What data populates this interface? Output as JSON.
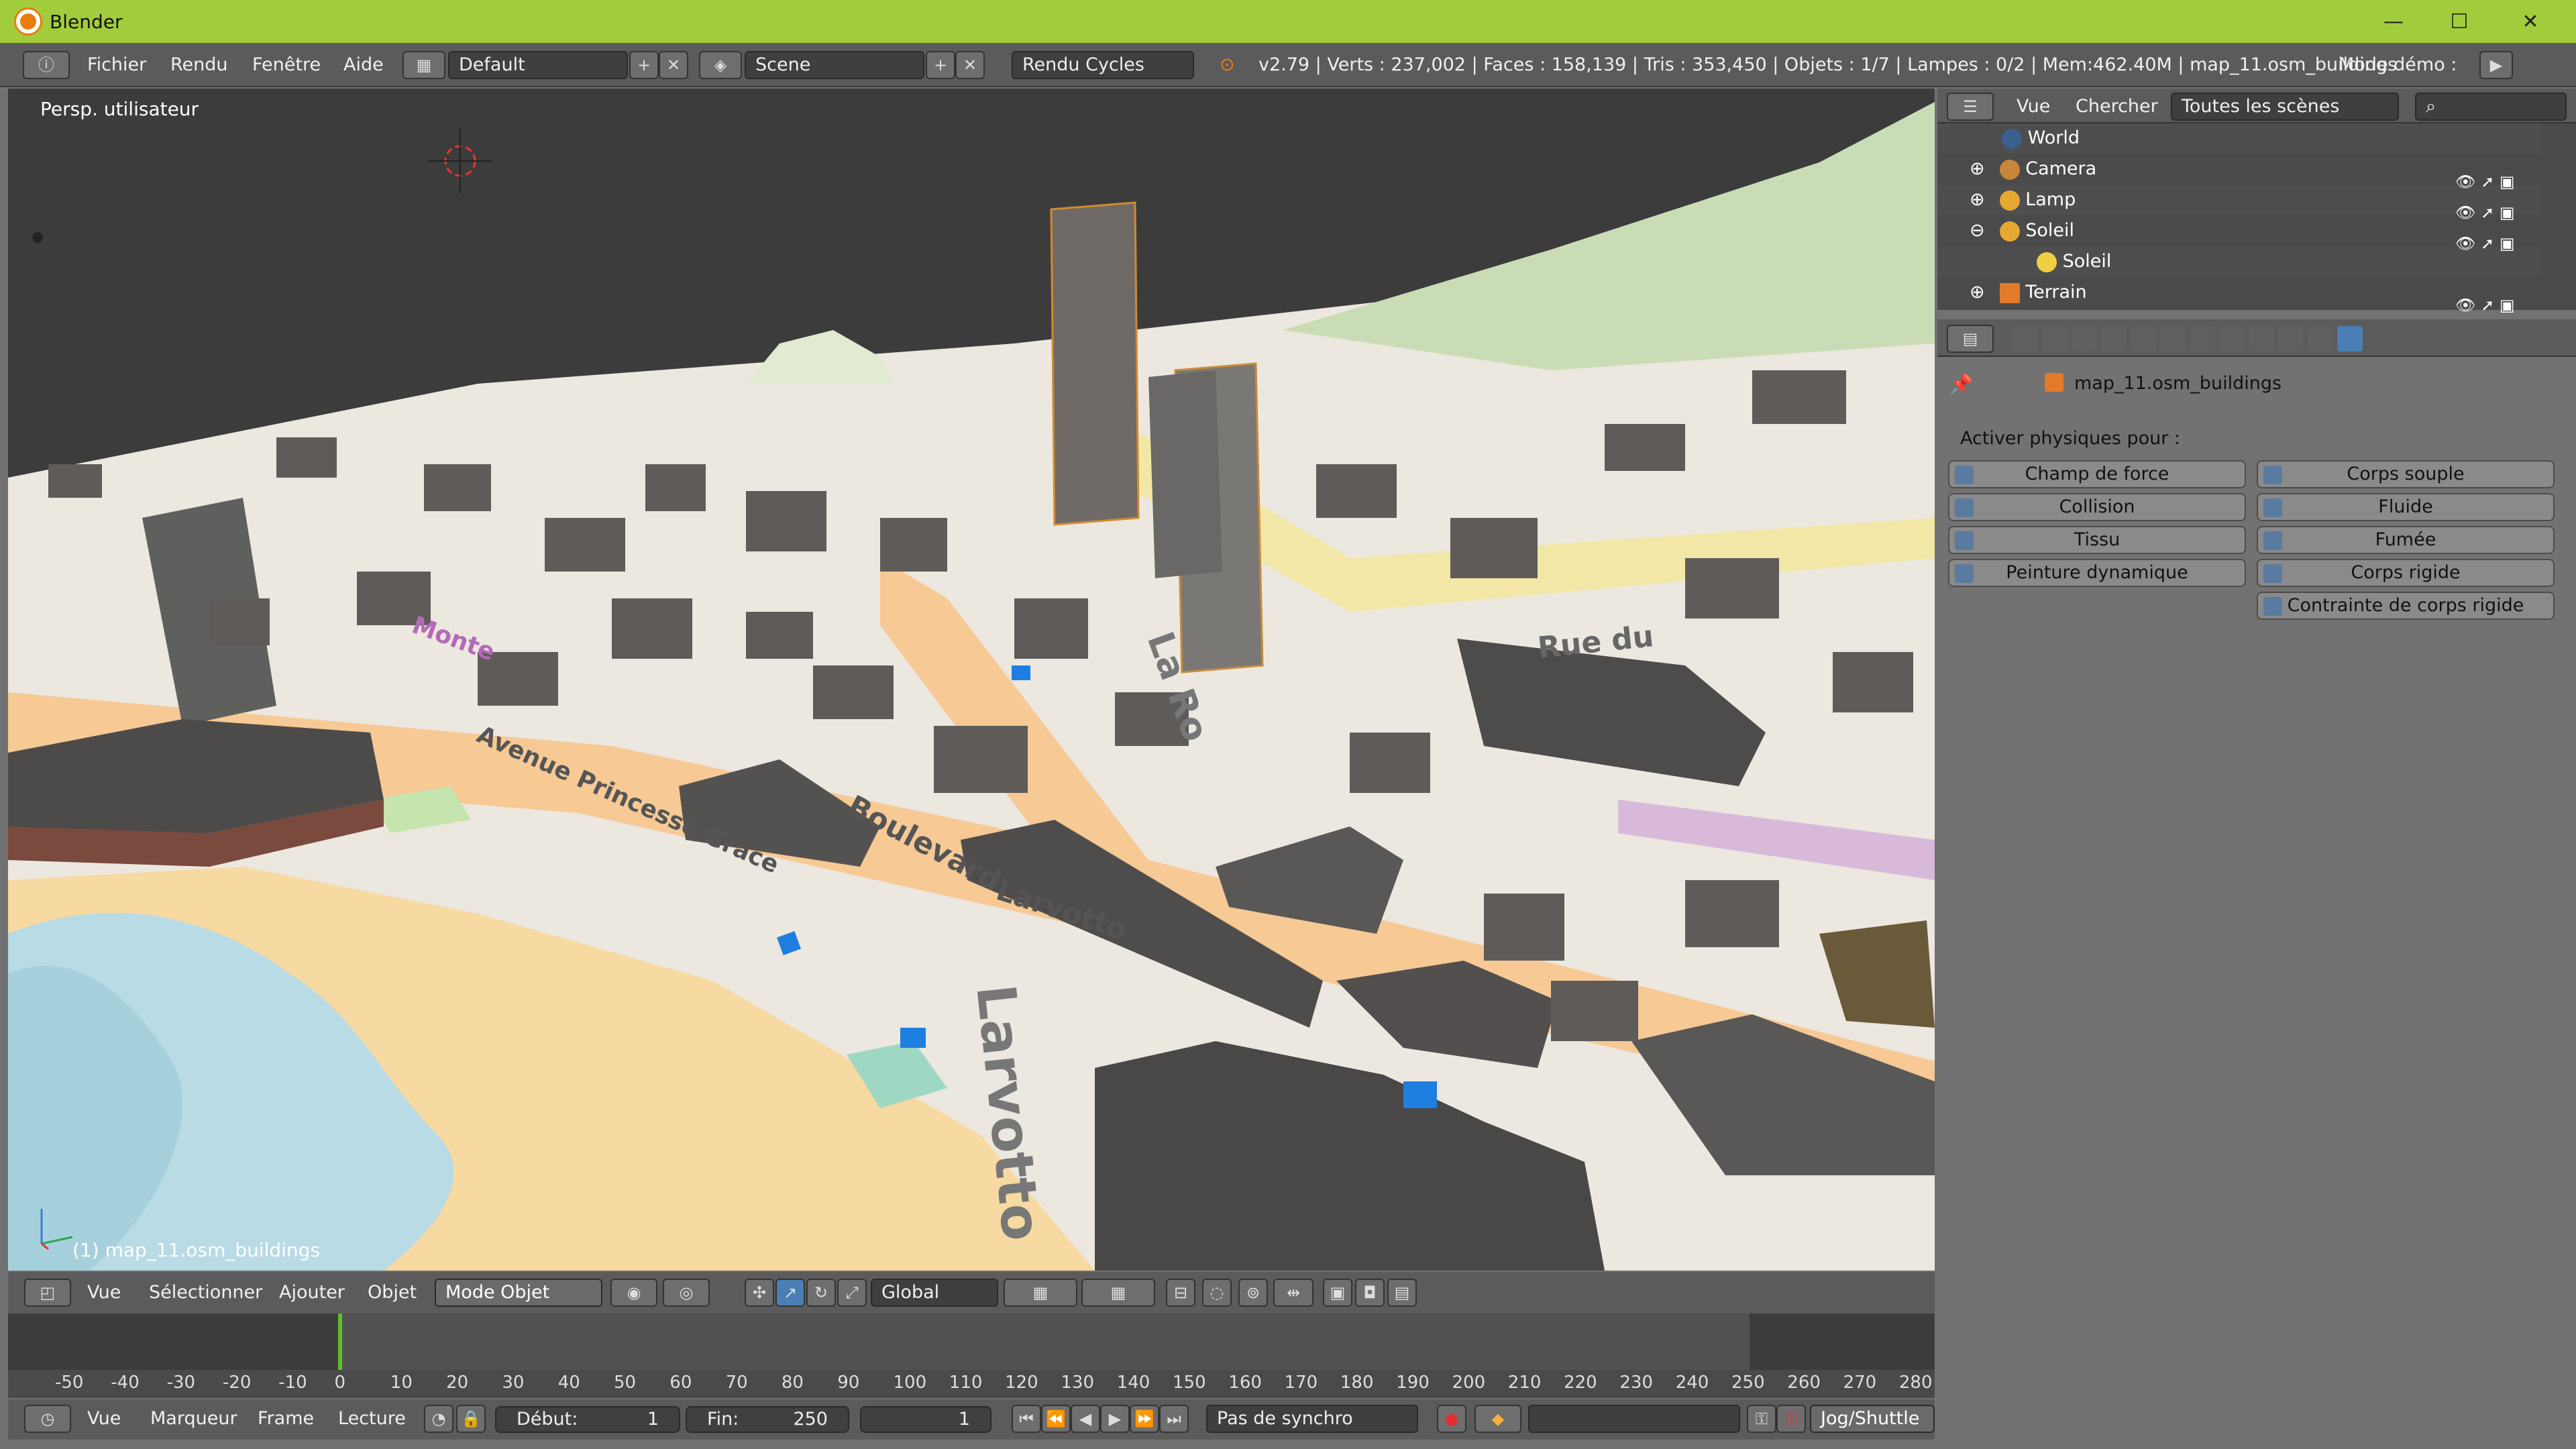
{
  "window": {
    "title": "Blender",
    "min": "—",
    "max": "☐",
    "close": "✕"
  },
  "menubar": {
    "menus": [
      "Fichier",
      "Rendu",
      "Fenêtre",
      "Aide"
    ],
    "layout": "Default",
    "scene": "Scene",
    "engine": "Rendu Cycles",
    "stats": "v2.79 | Verts : 237,002 | Faces : 158,139 | Tris : 353,450 | Objets : 1/7 | Lampes : 0/2 | Mem:462.40M | map_11.osm_buildings",
    "mode_demo": "Mode démo :"
  },
  "viewport": {
    "view_label": "Persp. utilisateur",
    "object_label": "(1) map_11.osm_buildings",
    "map_texts": [
      "Avenue Princesse Grace",
      "Larvotto",
      "Boulevard",
      "Larvotto",
      "La Ro",
      "Monte",
      "Rue du"
    ]
  },
  "outliner": {
    "menu": [
      "Vue",
      "Chercher"
    ],
    "filter": "Toutes les scènes",
    "rows": [
      {
        "name": "World",
        "icon": "world-icon"
      },
      {
        "name": "Camera",
        "icon": "camera-icon"
      },
      {
        "name": "Lamp",
        "icon": "lamp-icon"
      },
      {
        "name": "Soleil",
        "icon": "lamp-icon"
      },
      {
        "name": "Soleil",
        "icon": "sun-icon"
      },
      {
        "name": "Terrain",
        "icon": "mesh-icon"
      }
    ]
  },
  "properties": {
    "object": "map_11.osm_buildings",
    "section": "Activer physiques pour :",
    "buttons_left": [
      "Champ de force",
      "Collision",
      "Tissu",
      "Peinture dynamique"
    ],
    "buttons_right": [
      "Corps souple",
      "Fluide",
      "Fumée",
      "Corps rigide",
      "Contrainte de corps rigide"
    ]
  },
  "view_header": {
    "menus": [
      "Vue",
      "Sélectionner",
      "Ajouter",
      "Objet"
    ],
    "mode": "Mode Objet",
    "orientation": "Global"
  },
  "timeline": {
    "ticks": [
      "-50",
      "-40",
      "-30",
      "-20",
      "-10",
      "0",
      "10",
      "20",
      "30",
      "40",
      "50",
      "60",
      "70",
      "80",
      "90",
      "100",
      "110",
      "120",
      "130",
      "140",
      "150",
      "160",
      "170",
      "180",
      "190",
      "200",
      "210",
      "220",
      "230",
      "240",
      "250",
      "260",
      "270",
      "280"
    ],
    "current_frame_value": 0
  },
  "timeline_footer": {
    "menus": [
      "Vue",
      "Marqueur",
      "Frame",
      "Lecture"
    ],
    "start_label": "Début:",
    "start_value": "1",
    "end_label": "Fin:",
    "end_value": "250",
    "current": "1",
    "sync": "Pas de synchro",
    "jog": "Jog/Shuttle"
  },
  "colors": {
    "accent": "#a3cc3c",
    "header": "#5b5b5b",
    "panel": "#727272",
    "selected_tab": "#4a7fb5"
  }
}
